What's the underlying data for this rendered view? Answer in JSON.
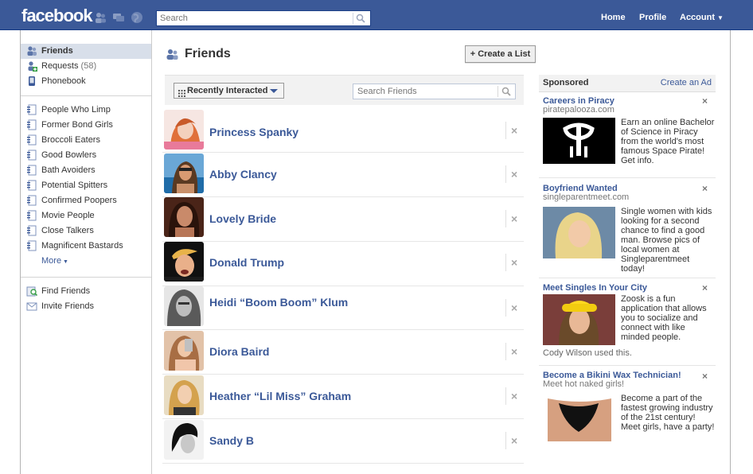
{
  "topbar": {
    "logo": "facebook",
    "search_placeholder": "Search",
    "nav": [
      "Home",
      "Profile",
      "Account"
    ]
  },
  "sidebar": {
    "items": [
      {
        "label": "Friends",
        "selected": true,
        "icon": "friends-icon"
      },
      {
        "label": "Requests",
        "count": "(58)",
        "icon": "requests-icon"
      },
      {
        "label": "Phonebook",
        "icon": "phonebook-icon"
      }
    ],
    "lists": [
      "People Who Limp",
      "Former Bond Girls",
      "Broccoli Eaters",
      "Good Bowlers",
      "Bath Avoiders",
      "Potential Spitters",
      "Confirmed Poopers",
      "Movie People",
      "Close Talkers",
      "Magnificent Bastards"
    ],
    "more": "More",
    "bottom": [
      {
        "label": "Find Friends",
        "icon": "find-friends-icon"
      },
      {
        "label": "Invite Friends",
        "icon": "invite-friends-icon"
      }
    ]
  },
  "main": {
    "title": "Friends",
    "create_list": "Create a List",
    "filter_label": "Recently Interacted",
    "search_friends_placeholder": "Search Friends",
    "friends": [
      {
        "name": "Princess Spanky",
        "remove": "×"
      },
      {
        "name": "Abby Clancy",
        "remove": "×"
      },
      {
        "name": "Lovely Bride",
        "remove": "×"
      },
      {
        "name": "Donald Trump",
        "remove": "×"
      },
      {
        "name": "Heidi “Boom Boom” Klum",
        "remove": "×"
      },
      {
        "name": "Diora Baird",
        "remove": "×"
      },
      {
        "name": "Heather “Lil Miss” Graham",
        "remove": "×"
      },
      {
        "name": "Sandy B",
        "remove": "×"
      }
    ]
  },
  "ads": {
    "header": "Sponsored",
    "create": "Create an Ad",
    "items": [
      {
        "title": "Careers in Piracy",
        "url": "piratepalooza.com",
        "body": "Earn an online Bachelor of Science in Piracy from the world's most famous Space Pirate! Get info.",
        "close": "×"
      },
      {
        "title": "Boyfriend Wanted",
        "url": "singleparentmeet.com",
        "body": "Single women with kids looking for a second chance to find a good man. Browse pics of local women at Singleparentmeet today!",
        "close": "×"
      },
      {
        "title": "Meet Singles In Your City",
        "url": "",
        "body": "Zoosk is a fun application that allows you to socialize and connect with like minded people.",
        "social": "Cody Wilson used this.",
        "close": "×"
      },
      {
        "title": "Become a Bikini Wax Technician!",
        "url": "Meet hot naked girls!",
        "body": "Become a part of the fastest growing industry of the 21st century! Meet girls, have a party!",
        "close": "×"
      }
    ]
  },
  "colors": {
    "brand": "#3b5998",
    "selected_nav": "#d8dfea",
    "link": "#3b5998"
  }
}
